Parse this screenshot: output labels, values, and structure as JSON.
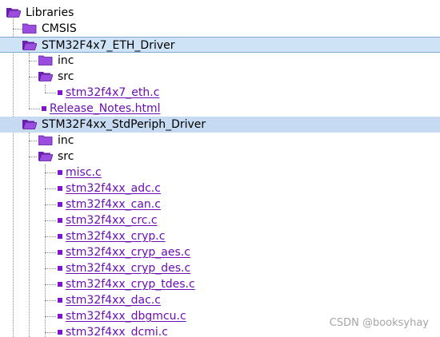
{
  "tree": {
    "root": {
      "label": "Libraries"
    },
    "cmsis": {
      "label": "CMSIS"
    },
    "eth_driver": {
      "label": "STM32F4x7_ETH_Driver",
      "inc": "inc",
      "src": "src",
      "files": [
        "stm32f4x7_eth.c"
      ],
      "release_notes": "Release_Notes.html"
    },
    "std_driver": {
      "label": "STM32F4xx_StdPeriph_Driver",
      "inc": "inc",
      "src": "src",
      "files": [
        "misc.c",
        "stm32f4xx_adc.c",
        "stm32f4xx_can.c",
        "stm32f4xx_crc.c",
        "stm32f4xx_cryp.c",
        "stm32f4xx_cryp_aes.c",
        "stm32f4xx_cryp_des.c",
        "stm32f4xx_cryp_tdes.c",
        "stm32f4xx_dac.c",
        "stm32f4xx_dbgmcu.c",
        "stm32f4xx_dcmi.c"
      ]
    }
  },
  "watermark": "CSDN @booksyhay",
  "colors": {
    "folder": "#8a2be2",
    "file": "#7b16c9",
    "selection": "#cfe3f7"
  },
  "icons": {
    "folder": "folder-open-icon",
    "file": "file-icon"
  }
}
